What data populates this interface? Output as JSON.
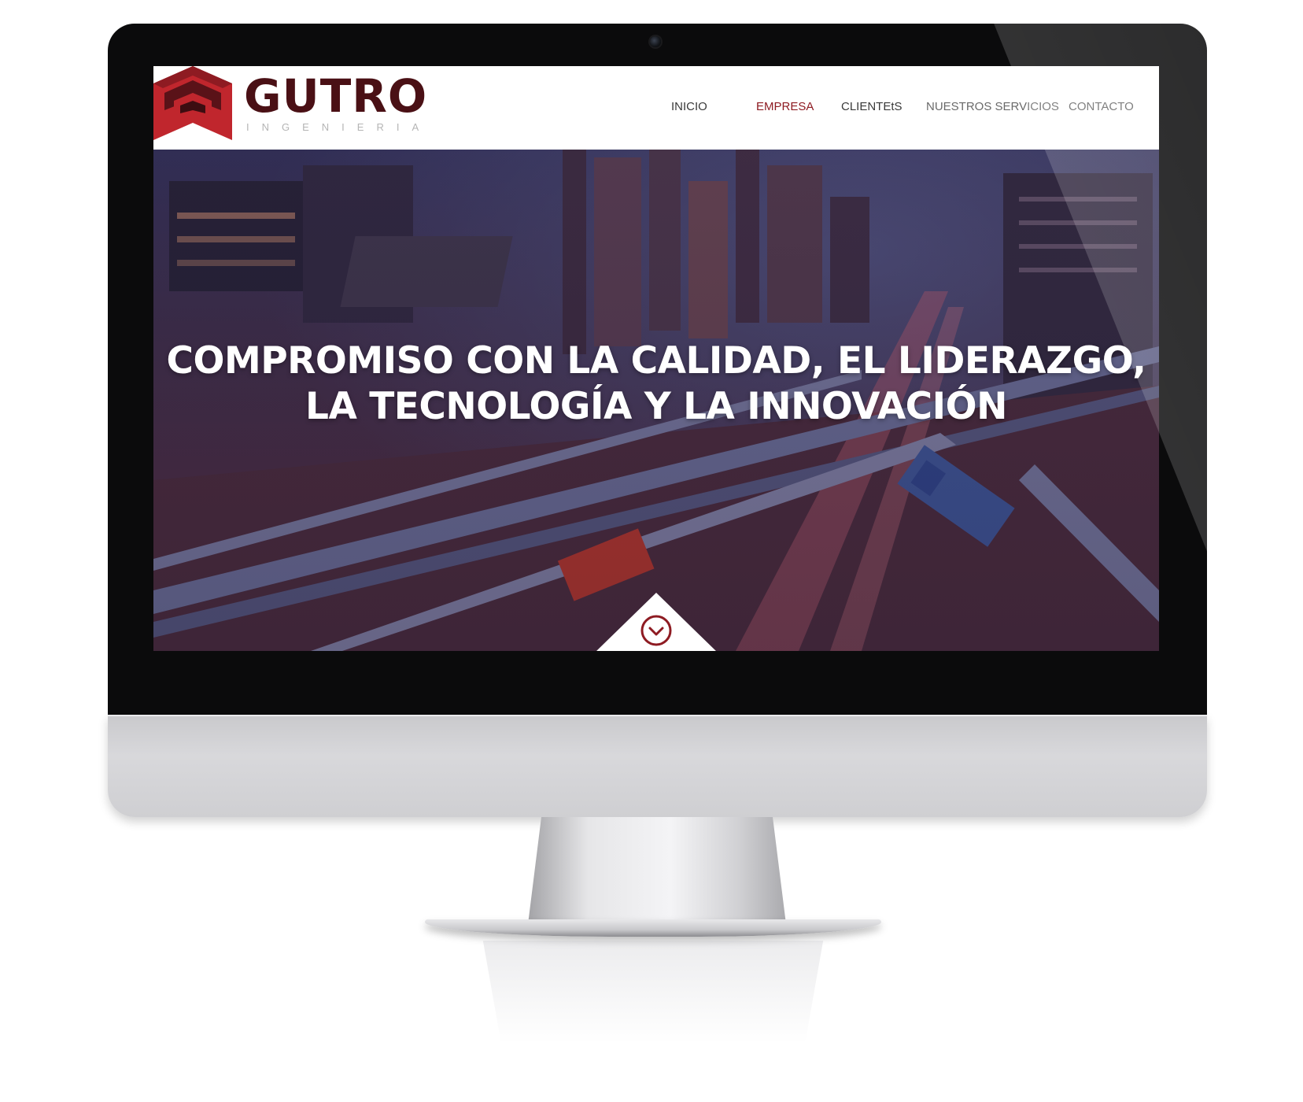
{
  "brand": {
    "name": "GUTRO",
    "tagline": "INGENIERIA",
    "colors": {
      "primary": "#4a1015",
      "accent": "#c0262d",
      "nav_active": "#8e1b22"
    }
  },
  "nav": {
    "items": [
      {
        "label": "INICIO",
        "active": false
      },
      {
        "label": "EMPRESA",
        "active": true
      },
      {
        "label": "CLIENTEtS",
        "active": false
      },
      {
        "label": "NUESTROS SERVICIOS",
        "active": false
      },
      {
        "label": "CONTACTO",
        "active": false
      }
    ]
  },
  "hero": {
    "title_line1": "COMPROMISO CON LA CALIDAD, EL LIDERAZGO,",
    "title_line2": "LA TECNOLOGÍA Y LA INNOVACIÓN",
    "background": "industrial-plant-night-photo",
    "scroll_icon": "chevron-down-circle-icon"
  }
}
